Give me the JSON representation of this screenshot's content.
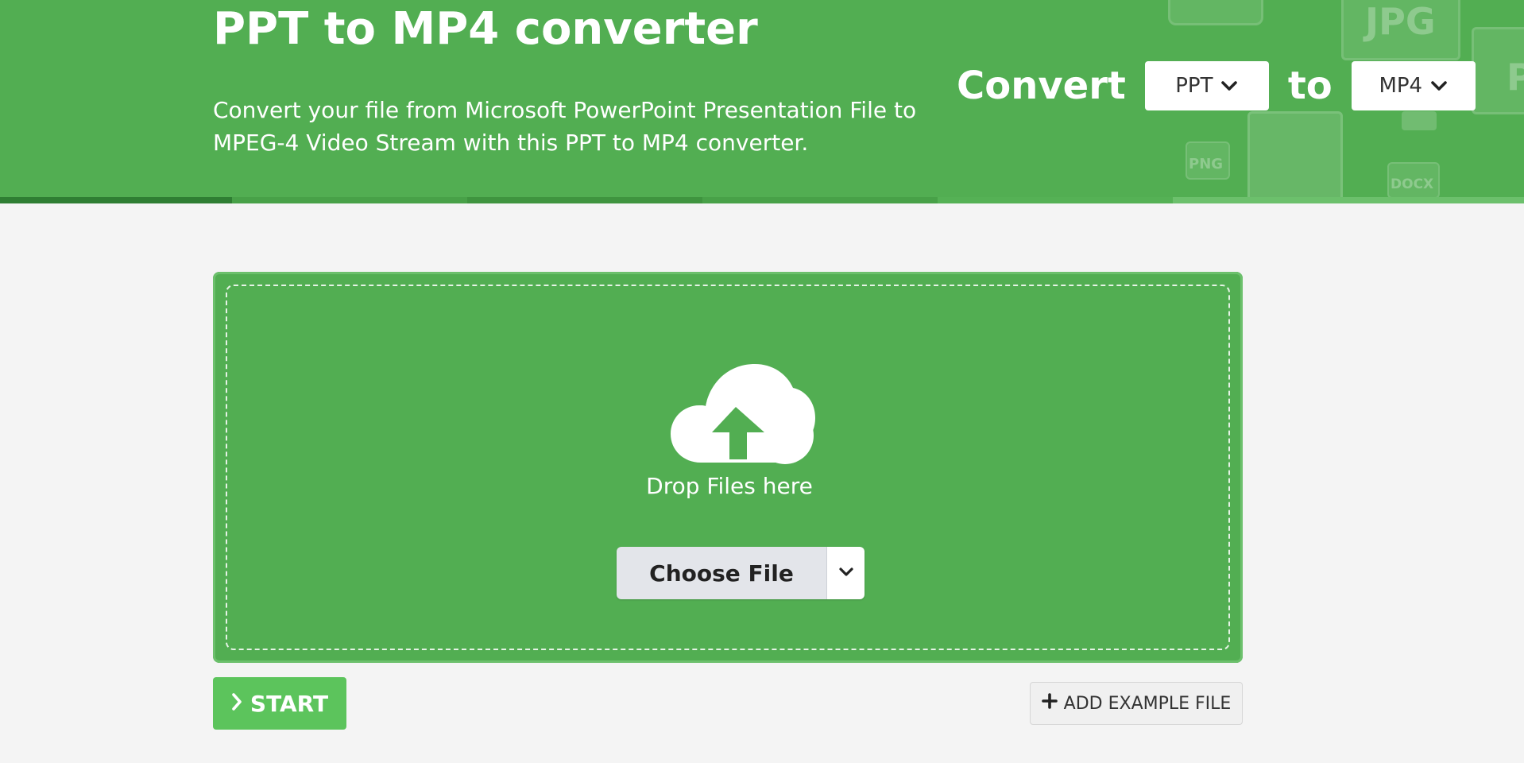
{
  "hero": {
    "title": "PPT to MP4 converter",
    "description": "Convert your file from Microsoft PowerPoint Presentation File to MPEG-4 Video Stream with this PPT to MP4 converter.",
    "background_color": "#52ae52",
    "background_icons": [
      "JPG",
      "PNG",
      "DOCX",
      "P"
    ]
  },
  "converter": {
    "convert_label": "Convert",
    "from_format": "PPT",
    "to_label": "to",
    "to_format": "MP4"
  },
  "upload": {
    "drop_text": "Drop Files here",
    "choose_file_label": "Choose File"
  },
  "actions": {
    "start_label": "START",
    "add_example_label": "ADD EXAMPLE FILE"
  },
  "colors": {
    "accent": "#52ae52",
    "start_button": "#5cc45c",
    "page_background": "#f4f4f4"
  }
}
